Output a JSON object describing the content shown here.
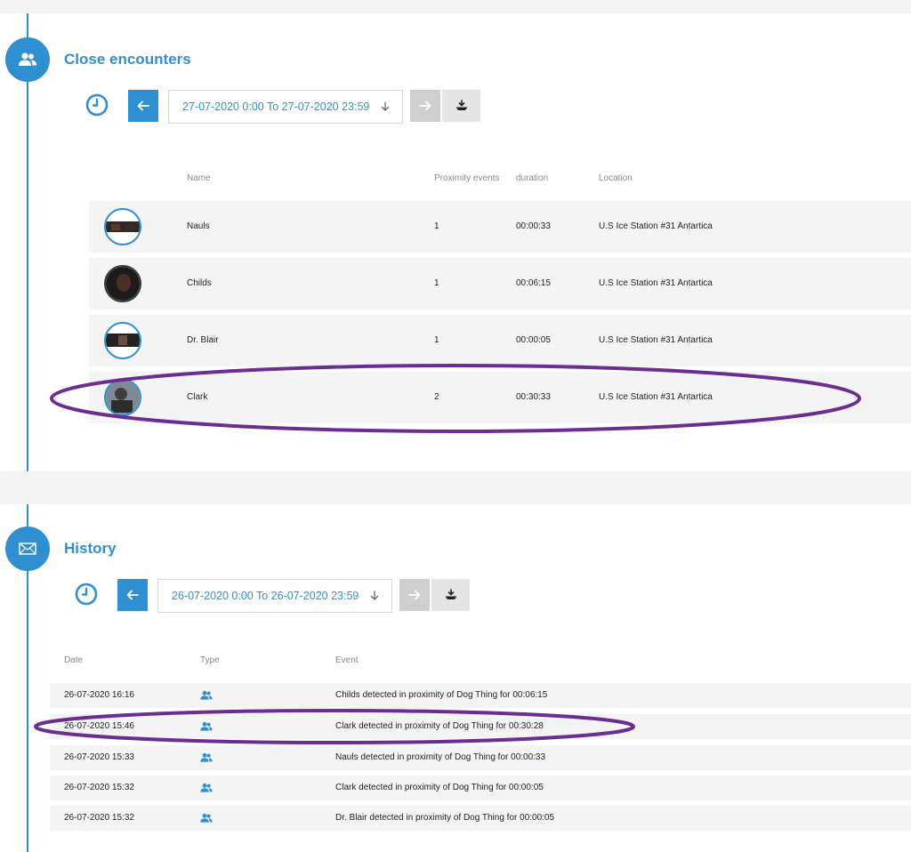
{
  "encounters": {
    "title": "Close encounters",
    "date_range": "27-07-2020 0:00 To 27-07-2020 23:59",
    "columns": {
      "name": "Name",
      "proximity": "Proximity events",
      "duration": "duration",
      "location": "Location"
    },
    "rows": [
      {
        "name": "Nauls",
        "proximity": "1",
        "duration": "00:00:33",
        "location": "U.S Ice Station #31 Antartica"
      },
      {
        "name": "Childs",
        "proximity": "1",
        "duration": "00:06:15",
        "location": "U.S Ice Station #31 Antartica"
      },
      {
        "name": "Dr. Blair",
        "proximity": "1",
        "duration": "00:00:05",
        "location": "U.S Ice Station #31 Antartica"
      },
      {
        "name": "Clark",
        "proximity": "2",
        "duration": "00:30:33",
        "location": "U.S Ice Station #31 Antartica"
      }
    ]
  },
  "history": {
    "title": "History",
    "date_range": "26-07-2020 0:00 To 26-07-2020 23:59",
    "columns": {
      "date": "Date",
      "type": "Type",
      "event": "Event"
    },
    "rows": [
      {
        "date": "26-07-2020 16:16",
        "type_icon": "users-icon",
        "event": "Childs detected in proximity of Dog Thing for 00:06:15"
      },
      {
        "date": "26-07-2020 15:46",
        "type_icon": "users-icon",
        "event": "Clark detected in proximity of Dog Thing for 00:30:28"
      },
      {
        "date": "26-07-2020 15:33",
        "type_icon": "users-icon",
        "event": "Nauls detected in proximity of Dog Thing for 00:00:33"
      },
      {
        "date": "26-07-2020 15:32",
        "type_icon": "users-icon",
        "event": "Clark detected in proximity of Dog Thing for 00:00:05"
      },
      {
        "date": "26-07-2020 15:32",
        "type_icon": "users-icon",
        "event": "Dr. Blair detected in proximity of Dog Thing for 00:00:05"
      }
    ]
  },
  "colors": {
    "accent": "#2f8fd1",
    "highlight": "#6b2d8f",
    "row_bg": "#f4f4f4"
  }
}
